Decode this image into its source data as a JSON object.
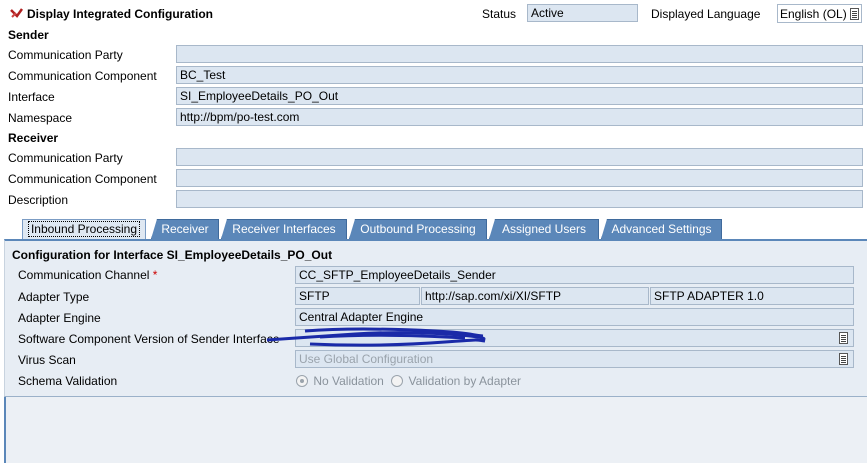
{
  "header": {
    "title": "Display Integrated Configuration",
    "status_label": "Status",
    "status_value": "Active",
    "language_label": "Displayed Language",
    "language_value": "English (OL)"
  },
  "sender": {
    "section_label": "Sender",
    "party_label": "Communication Party",
    "party_value": "",
    "component_label": "Communication Component",
    "component_value": "BC_Test",
    "interface_label": "Interface",
    "interface_value": "SI_EmployeeDetails_PO_Out",
    "namespace_label": "Namespace",
    "namespace_value": "http://bpm/po-test.com"
  },
  "receiver": {
    "section_label": "Receiver",
    "party_label": "Communication Party",
    "party_value": "",
    "component_label": "Communication Component",
    "component_value": "",
    "description_label": "Description",
    "description_value": ""
  },
  "tabs": [
    {
      "label": "Inbound Processing"
    },
    {
      "label": "Receiver"
    },
    {
      "label": "Receiver Interfaces"
    },
    {
      "label": "Outbound Processing"
    },
    {
      "label": "Assigned Users"
    },
    {
      "label": "Advanced Settings"
    }
  ],
  "inbound": {
    "heading": "Configuration for Interface SI_EmployeeDetails_PO_Out",
    "channel_label": "Communication Channel",
    "required_mark": "*",
    "channel_value": "CC_SFTP_EmployeeDetails_Sender",
    "adapter_type_label": "Adapter Type",
    "adapter_type_name": "SFTP",
    "adapter_type_namespace": "http://sap.com/xi/XI/SFTP",
    "adapter_type_swcv": "SFTP ADAPTER 1.0",
    "adapter_engine_label": "Adapter Engine",
    "adapter_engine_value": "Central Adapter Engine",
    "swcv_label": "Software Component Version of Sender Interface",
    "swcv_value": "",
    "virus_scan_label": "Virus Scan",
    "virus_scan_value": "Use Global Configuration",
    "schema_label": "Schema Validation",
    "schema_opt1": "No Validation",
    "schema_opt2": "Validation by Adapter"
  },
  "colors": {
    "tab_bg": "#5b87b9",
    "field_bg": "#dce6f1",
    "panel_bg": "#e7edf4",
    "required": "#cc0000",
    "scribble": "#1a2aa8"
  }
}
